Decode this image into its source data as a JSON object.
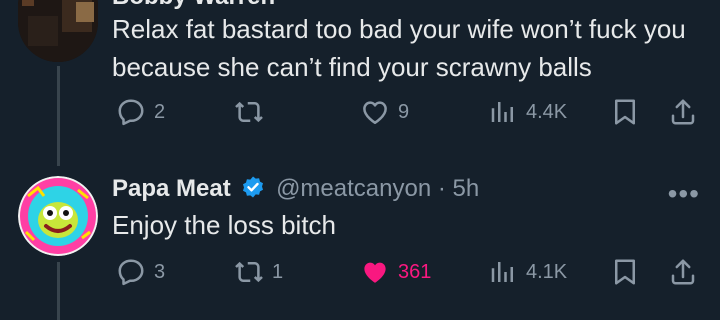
{
  "colors": {
    "background": "#15202b",
    "text": "#e7e9ea",
    "muted": "#8b98a5",
    "like": "#f91880",
    "verified": "#1d9bf0"
  },
  "tweet1": {
    "author_partial": "Bobby Warren",
    "text": "Relax fat bastard too bad your wife won’t fuck you because she can’t find your scrawny balls",
    "actions": {
      "reply_count": "2",
      "retweet_count": "",
      "like_count": "9",
      "views": "4.4K"
    }
  },
  "tweet2": {
    "display_name": "Papa Meat",
    "handle": "@meatcanyon",
    "time": "· 5h",
    "more": "•••",
    "text": "Enjoy the loss bitch",
    "actions": {
      "reply_count": "3",
      "retweet_count": "1",
      "like_count": "361",
      "liked": true,
      "views": "4.1K"
    }
  },
  "icons": {
    "reply": "reply-icon",
    "retweet": "retweet-icon",
    "like": "heart-icon",
    "views": "views-icon",
    "bookmark": "bookmark-icon",
    "share": "share-icon",
    "verified": "verified-badge-icon"
  }
}
